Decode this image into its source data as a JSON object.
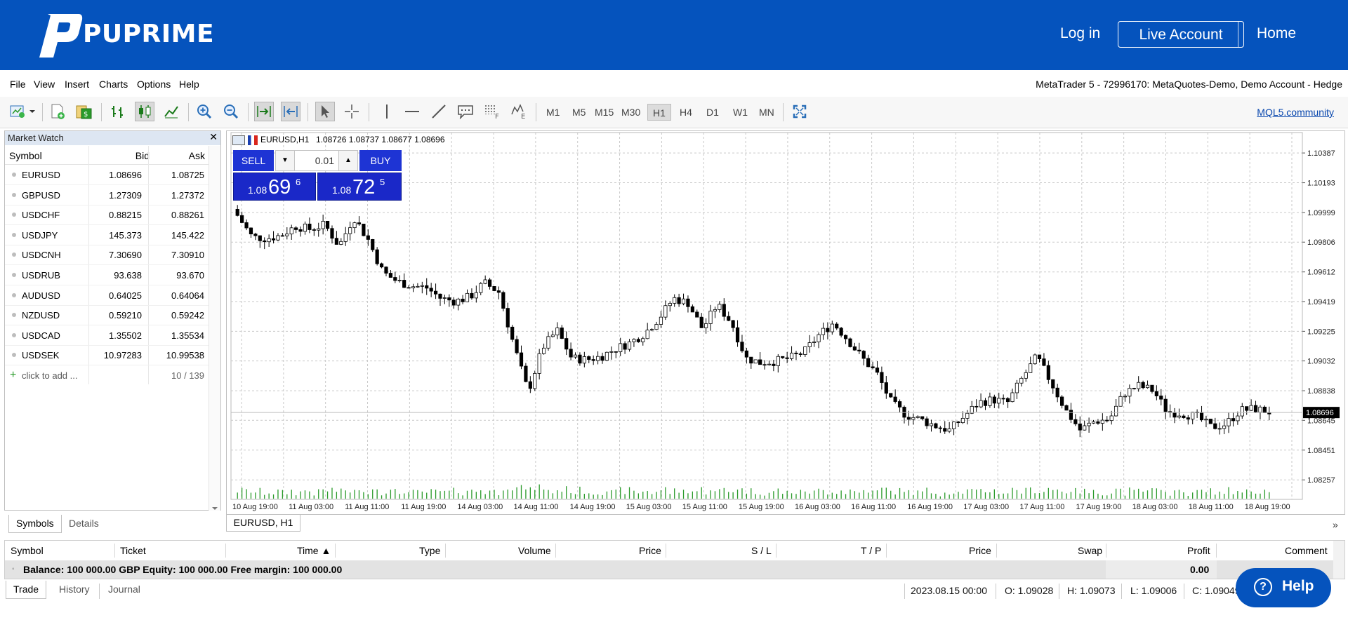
{
  "header": {
    "brand": "PUPRIME",
    "login": "Log in",
    "live_account": "Live Account",
    "home": "Home",
    "bg_color": "#0553bd"
  },
  "menu": {
    "items": [
      "File",
      "View",
      "Insert",
      "Charts",
      "Options",
      "Help"
    ],
    "account": "MetaTrader 5 - 72996170: MetaQuotes-Demo, Demo Account - Hedge"
  },
  "toolbar": {
    "timeframes": [
      "M1",
      "M5",
      "M15",
      "M30",
      "H1",
      "H4",
      "D1",
      "W1",
      "MN"
    ],
    "active_timeframe": "H1",
    "mql5": "MQL5.community"
  },
  "market_watch": {
    "title": "Market Watch",
    "columns": [
      "Symbol",
      "Bid",
      "Ask"
    ],
    "rows": [
      {
        "symbol": "EURUSD",
        "bid": "1.08696",
        "ask": "1.08725"
      },
      {
        "symbol": "GBPUSD",
        "bid": "1.27309",
        "ask": "1.27372"
      },
      {
        "symbol": "USDCHF",
        "bid": "0.88215",
        "ask": "0.88261"
      },
      {
        "symbol": "USDJPY",
        "bid": "145.373",
        "ask": "145.422"
      },
      {
        "symbol": "USDCNH",
        "bid": "7.30690",
        "ask": "7.30910"
      },
      {
        "symbol": "USDRUB",
        "bid": "93.638",
        "ask": "93.670"
      },
      {
        "symbol": "AUDUSD",
        "bid": "0.64025",
        "ask": "0.64064"
      },
      {
        "symbol": "NZDUSD",
        "bid": "0.59210",
        "ask": "0.59242"
      },
      {
        "symbol": "USDCAD",
        "bid": "1.35502",
        "ask": "1.35534"
      },
      {
        "symbol": "USDSEK",
        "bid": "10.97283",
        "ask": "10.99538"
      }
    ],
    "add_label": "click to add ...",
    "count": "10 / 139",
    "tabs": [
      "Symbols",
      "Details"
    ]
  },
  "chart": {
    "header": "EURUSD,H1",
    "ohlc": "1.08726 1.08737 1.08677 1.08696",
    "tab": "EURUSD, H1",
    "trade": {
      "sell": "SELL",
      "buy": "BUY",
      "volume": "0.01",
      "bid_prefix": "1.08",
      "bid_big": "69",
      "bid_sup": "6",
      "ask_prefix": "1.08",
      "ask_big": "72",
      "ask_sup": "5"
    },
    "current_price": "1.08696"
  },
  "chart_data": {
    "type": "candlestick",
    "symbol": "EURUSD",
    "timeframe": "H1",
    "y_ticks": [
      1.10387,
      1.10193,
      1.09999,
      1.09806,
      1.09612,
      1.09419,
      1.09225,
      1.09032,
      1.08838,
      1.08645,
      1.08451,
      1.08257
    ],
    "ylim": [
      1.0813,
      1.1052
    ],
    "x_tick_labels": [
      "10 Aug 19:00",
      "11 Aug 03:00",
      "11 Aug 11:00",
      "11 Aug 19:00",
      "14 Aug 03:00",
      "14 Aug 11:00",
      "14 Aug 19:00",
      "15 Aug 03:00",
      "15 Aug 11:00",
      "15 Aug 19:00",
      "16 Aug 03:00",
      "16 Aug 11:00",
      "16 Aug 19:00",
      "17 Aug 03:00",
      "17 Aug 11:00",
      "17 Aug 19:00",
      "18 Aug 03:00",
      "18 Aug 11:00",
      "18 Aug 19:00"
    ],
    "close_path": [
      1.0998,
      1.0984,
      1.0983,
      1.0985,
      1.0991,
      1.0989,
      1.0992,
      1.0978,
      1.0997,
      1.0982,
      1.0961,
      1.0955,
      1.0952,
      1.0951,
      1.0944,
      1.0942,
      1.0945,
      1.0954,
      1.0948,
      1.0914,
      1.0883,
      1.0912,
      1.0923,
      1.0905,
      1.0904,
      1.0906,
      1.0911,
      1.0915,
      1.0921,
      1.0931,
      1.0944,
      1.0941,
      1.0924,
      1.094,
      1.0928,
      1.0905,
      1.0902,
      1.0903,
      1.0905,
      1.0909,
      1.092,
      1.0928,
      1.0917,
      1.0905,
      1.0895,
      1.0876,
      1.0868,
      1.0865,
      1.0861,
      1.0858,
      1.0867,
      1.0876,
      1.0878,
      1.0876,
      1.0892,
      1.0906,
      1.0889,
      1.0871,
      1.0858,
      1.0864,
      1.0865,
      1.0882,
      1.0887,
      1.0884,
      1.087,
      1.0869,
      1.0867,
      1.086,
      1.0862,
      1.0871,
      1.0872,
      1.087
    ],
    "volume_scale": "relative"
  },
  "terminal": {
    "columns": [
      "Symbol",
      "Ticket",
      "Time ▲",
      "Type",
      "Volume",
      "Price",
      "S / L",
      "T / P",
      "Price",
      "Swap",
      "Profit",
      "Comment"
    ],
    "balance": "Balance: 100 000.00 GBP  Equity: 100 000.00  Free margin: 100 000.00",
    "profit": "0.00",
    "tabs": [
      "Trade",
      "History",
      "Journal"
    ]
  },
  "status": {
    "datetime": "2023.08.15 00:00",
    "open": "O: 1.09028",
    "high": "H: 1.09073",
    "low": "L: 1.09006",
    "close": "C: 1.09049"
  },
  "help": {
    "label": "Help"
  }
}
